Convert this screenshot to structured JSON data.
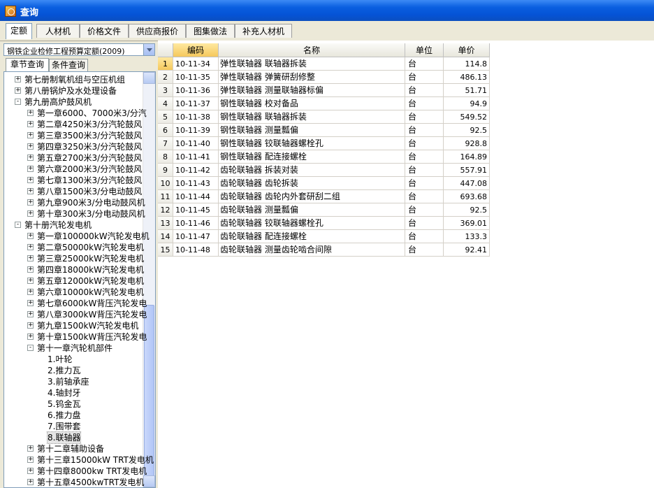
{
  "window": {
    "title": "查询"
  },
  "tabs": [
    "定额",
    "人材机",
    "价格文件",
    "供应商报价",
    "图集做法",
    "补充人材机"
  ],
  "left": {
    "combo_value": "钢铁企业检修工程预算定额(2009)",
    "subtabs": [
      "章节查询",
      "条件查询"
    ],
    "tree": [
      {
        "label": "第七册制氧机组与空压机组",
        "level": 0,
        "toggle": "+"
      },
      {
        "label": "第八册锅炉及水处理设备",
        "level": 0,
        "toggle": "+"
      },
      {
        "label": "第九册高炉鼓风机",
        "level": 0,
        "toggle": "-"
      },
      {
        "label": "第一章6000、7000米3/分汽",
        "level": 1,
        "toggle": "+"
      },
      {
        "label": "第二章4250米3/分汽轮鼓风",
        "level": 1,
        "toggle": "+"
      },
      {
        "label": "第三章3500米3/分汽轮鼓风",
        "level": 1,
        "toggle": "+"
      },
      {
        "label": "第四章3250米3/分汽轮鼓风",
        "level": 1,
        "toggle": "+"
      },
      {
        "label": "第五章2700米3/分汽轮鼓风",
        "level": 1,
        "toggle": "+"
      },
      {
        "label": "第六章2000米3/分汽轮鼓风",
        "level": 1,
        "toggle": "+"
      },
      {
        "label": "第七章1300米3/分汽轮鼓风",
        "level": 1,
        "toggle": "+"
      },
      {
        "label": "第八章1500米3/分电动鼓风",
        "level": 1,
        "toggle": "+"
      },
      {
        "label": "第九章900米3/分电动鼓风机",
        "level": 1,
        "toggle": "+"
      },
      {
        "label": "第十章300米3/分电动鼓风机",
        "level": 1,
        "toggle": "+"
      },
      {
        "label": "第十册汽轮发电机",
        "level": 0,
        "toggle": "-"
      },
      {
        "label": "第一章100000kW汽轮发电机",
        "level": 1,
        "toggle": "+"
      },
      {
        "label": "第二章50000kW汽轮发电机",
        "level": 1,
        "toggle": "+"
      },
      {
        "label": "第三章25000kW汽轮发电机",
        "level": 1,
        "toggle": "+"
      },
      {
        "label": "第四章18000kW汽轮发电机",
        "level": 1,
        "toggle": "+"
      },
      {
        "label": "第五章12000kW汽轮发电机",
        "level": 1,
        "toggle": "+"
      },
      {
        "label": "第六章10000kW汽轮发电机",
        "level": 1,
        "toggle": "+"
      },
      {
        "label": "第七章6000kW背压汽轮发电",
        "level": 1,
        "toggle": "+"
      },
      {
        "label": "第八章3000kW背压汽轮发电",
        "level": 1,
        "toggle": "+"
      },
      {
        "label": "第九章1500kW汽轮发电机",
        "level": 1,
        "toggle": "+"
      },
      {
        "label": "第十章1500kW背压汽轮发电",
        "level": 1,
        "toggle": "+"
      },
      {
        "label": "第十一章汽轮机部件",
        "level": 1,
        "toggle": "-"
      },
      {
        "label": "1.叶轮",
        "level": 2,
        "toggle": ""
      },
      {
        "label": "2.推力瓦",
        "level": 2,
        "toggle": ""
      },
      {
        "label": "3.前轴承座",
        "level": 2,
        "toggle": ""
      },
      {
        "label": "4.轴封牙",
        "level": 2,
        "toggle": ""
      },
      {
        "label": "5.钨金瓦",
        "level": 2,
        "toggle": ""
      },
      {
        "label": "6.推力盘",
        "level": 2,
        "toggle": ""
      },
      {
        "label": "7.围带套",
        "level": 2,
        "toggle": ""
      },
      {
        "label": "8.联轴器",
        "level": 2,
        "toggle": "",
        "selected": true
      },
      {
        "label": "第十二章辅助设备",
        "level": 1,
        "toggle": "+"
      },
      {
        "label": "第十三章15000kW TRT发电机",
        "level": 1,
        "toggle": "+"
      },
      {
        "label": "第十四章8000kw TRT发电机",
        "level": 1,
        "toggle": "+"
      },
      {
        "label": "第十五章4500kwTRT发电机",
        "level": 1,
        "toggle": "+"
      }
    ]
  },
  "grid": {
    "headers": [
      "编码",
      "名称",
      "单位",
      "单价"
    ],
    "rows": [
      {
        "no": "1",
        "code": "10-11-34",
        "name": "弹性联轴器 联轴器拆装",
        "unit": "台",
        "price": "114.8"
      },
      {
        "no": "2",
        "code": "10-11-35",
        "name": "弹性联轴器 弹簧研刮修整",
        "unit": "台",
        "price": "486.13"
      },
      {
        "no": "3",
        "code": "10-11-36",
        "name": "弹性联轴器 测量联轴器标偏",
        "unit": "台",
        "price": "51.71"
      },
      {
        "no": "4",
        "code": "10-11-37",
        "name": "钢性联轴器 校对备品",
        "unit": "台",
        "price": "94.9"
      },
      {
        "no": "5",
        "code": "10-11-38",
        "name": "钢性联轴器 联轴器拆装",
        "unit": "台",
        "price": "549.52"
      },
      {
        "no": "6",
        "code": "10-11-39",
        "name": "钢性联轴器 测量瓢偏",
        "unit": "台",
        "price": "92.5"
      },
      {
        "no": "7",
        "code": "10-11-40",
        "name": "钢性联轴器 铰联轴器螺栓孔",
        "unit": "台",
        "price": "928.8"
      },
      {
        "no": "8",
        "code": "10-11-41",
        "name": "钢性联轴器 配连接螺栓",
        "unit": "台",
        "price": "164.89"
      },
      {
        "no": "9",
        "code": "10-11-42",
        "name": "齿轮联轴器 拆装对装",
        "unit": "台",
        "price": "557.91"
      },
      {
        "no": "10",
        "code": "10-11-43",
        "name": "齿轮联轴器 齿轮拆装",
        "unit": "台",
        "price": "447.08"
      },
      {
        "no": "11",
        "code": "10-11-44",
        "name": "齿轮联轴器 齿轮内外套研刮二组",
        "unit": "台",
        "price": "693.68"
      },
      {
        "no": "12",
        "code": "10-11-45",
        "name": "齿轮联轴器 测量瓢偏",
        "unit": "台",
        "price": "92.5"
      },
      {
        "no": "13",
        "code": "10-11-46",
        "name": "齿轮联轴器 铰联轴器螺栓孔",
        "unit": "台",
        "price": "369.01"
      },
      {
        "no": "14",
        "code": "10-11-47",
        "name": "齿轮联轴器 配连接螺栓",
        "unit": "台",
        "price": "133.3"
      },
      {
        "no": "15",
        "code": "10-11-48",
        "name": "齿轮联轴器 测量齿轮啮合间隙",
        "unit": "台",
        "price": "92.41"
      }
    ]
  }
}
